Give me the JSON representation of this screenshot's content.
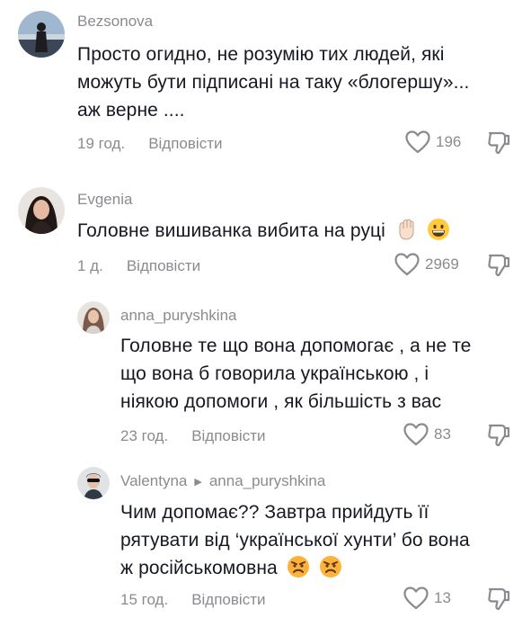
{
  "comments": [
    {
      "username": "Bezsonova",
      "lines": [
        "Просто огидно, не розумію тих людей, які",
        "можуть бути підписані на таку «блогершу»...",
        "аж верне ...."
      ],
      "time": "19 год.",
      "reply_label": "Відповісти",
      "likes": "196",
      "like_icon": "heart-outline",
      "dislike_icon": "thumbs-down"
    },
    {
      "username": "Evgenia",
      "lines": [
        "Головне вишиванка вибита на руці"
      ],
      "emojis": [
        "raised-fist",
        "grinning-face"
      ],
      "time": "1 д.",
      "reply_label": "Відповісти",
      "likes": "2969",
      "like_icon": "heart-outline",
      "dislike_icon": "thumbs-down"
    },
    {
      "username": "anna_puryshkina",
      "lines": [
        "Головне те що вона допомогає , а не те",
        "що вона б говорила українською , і",
        "ніякою допомоги , як більшість з вас"
      ],
      "time": "23 год.",
      "reply_label": "Відповісти",
      "likes": "83",
      "like_icon": "heart-outline",
      "dislike_icon": "thumbs-down"
    },
    {
      "username": "Valentyna",
      "reply_to": "anna_puryshkina",
      "lines": [
        "Чим допомає?? Завтра прийдуть її",
        "рятувати від ‘української хунти’ бо вона",
        "ж російськомовна"
      ],
      "emojis": [
        "angry-face",
        "angry-face"
      ],
      "time": "15 год.",
      "reply_label": "Відповісти",
      "likes": "13",
      "like_icon": "heart-outline",
      "dislike_icon": "thumbs-down"
    }
  ],
  "colors": {
    "text": "#161823",
    "muted": "#8a8b91",
    "background": "#ffffff"
  }
}
